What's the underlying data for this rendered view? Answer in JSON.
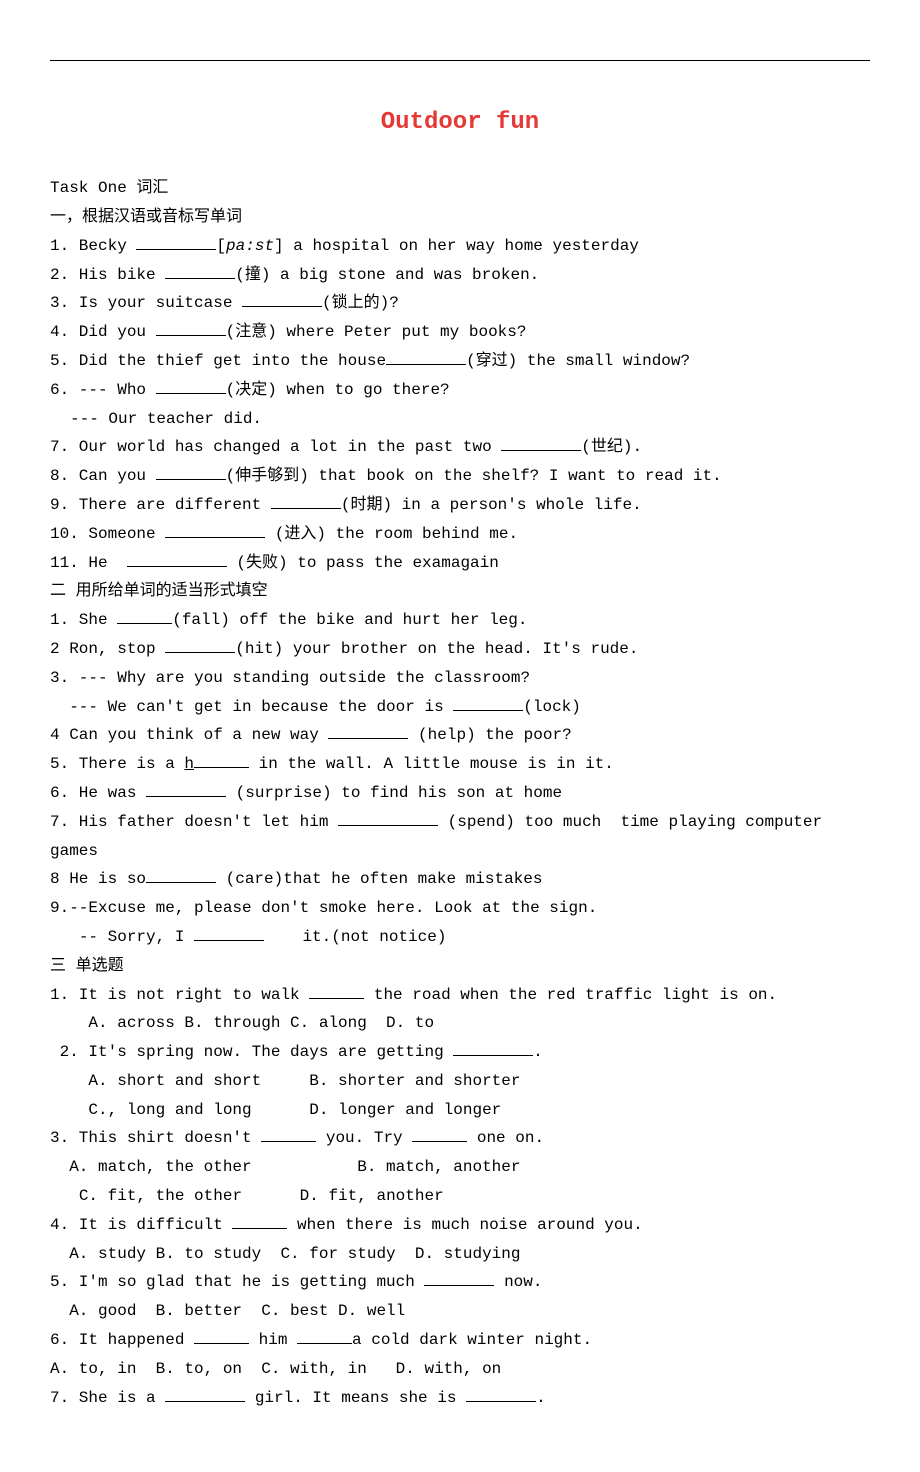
{
  "title": "Outdoor fun",
  "task_label": "Task One 词汇",
  "section1": {
    "heading": "一，根据汉语或音标写单词",
    "items": [
      {
        "pre": "1. Becky ",
        "post": "[",
        "ipa": "pa:st",
        "post2": "] a hospital on her way home yesterday"
      },
      {
        "pre": "2. His bike ",
        "post": "(撞) a big stone and was broken."
      },
      {
        "pre": "3. Is your suitcase ",
        "post": "(锁上的)?"
      },
      {
        "pre": "4. Did you ",
        "post": "(注意) where Peter put my books?"
      },
      {
        "pre": "5. Did the thief get into the house",
        "post": "(穿过) the small window?"
      },
      {
        "pre": "6. --- Who ",
        "post": "(决定) when to go there?"
      },
      {
        "sub": "--- Our teacher did."
      },
      {
        "pre": "7. Our world has changed a lot in the past two ",
        "post": "(世纪)."
      },
      {
        "pre": "8. Can you ",
        "post": "(伸手够到) that book on the shelf? I want to read it."
      },
      {
        "pre": "9. There are different ",
        "post": "(时期) in a person's whole life."
      },
      {
        "pre": "10. Someone ",
        "post": " (进入) the room behind me."
      },
      {
        "pre": "11. He  ",
        "post": " (失败) to pass the examagain"
      }
    ]
  },
  "section2": {
    "heading": "二 用所给单词的适当形式填空",
    "items": [
      {
        "pre": "1. She ",
        "post": "(fall) off the bike and hurt her leg."
      },
      {
        "pre": "2 Ron, stop ",
        "post": "(hit) your brother on the head. It's rude."
      },
      {
        "text": "3. --- Why are you standing outside the classroom?"
      },
      {
        "pre": "  --- We can't get in because the door is ",
        "post": "(lock)"
      },
      {
        "pre": "4 Can you think of a new way ",
        "post": " (help) the poor?"
      },
      {
        "pre": "5. There is a ",
        "uletter": "h",
        "post": " in the wall. A little mouse is in it."
      },
      {
        "pre": "6. He was ",
        "post": " (surprise) to find his son at home"
      },
      {
        "pre": "7. His father doesn't let him ",
        "post": " (spend) too much  time playing computer games"
      },
      {
        "pre": "8 He is so",
        "post": " (care)that he often make mistakes"
      },
      {
        "text": "9.--Excuse me, please don't smoke here. Look at the sign."
      },
      {
        "pre": "   -- Sorry, I ",
        "post": "    it.(not notice)"
      }
    ]
  },
  "section3": {
    "heading": "三 单选题",
    "items": [
      {
        "pre": "1. It is not right to walk ",
        "post": " the road when the red traffic light is on."
      },
      {
        "opts": "    A. across B. through C. along  D. to"
      },
      {
        "pre": " 2. It's spring now. The days are getting ",
        "post": "."
      },
      {
        "opts": "    A. short and short     B. shorter and shorter"
      },
      {
        "opts": "    C., long and long      D. longer and longer"
      },
      {
        "pre": "3. This shirt doesn't ",
        "mid": " you. Try ",
        "post": " one on."
      },
      {
        "opts": "  A. match, the other           B. match, another"
      },
      {
        "opts": "   C. fit, the other      D. fit, another"
      },
      {
        "pre": "4. It is difficult ",
        "post": " when there is much noise around you."
      },
      {
        "opts": "  A. study B. to study  C. for study  D. studying"
      },
      {
        "pre": "5. I'm so glad that he is getting much ",
        "post": " now."
      },
      {
        "opts": "  A. good  B. better  C. best D. well"
      },
      {
        "pre": "6. It happened ",
        "mid": " him ",
        "post": "a cold dark winter night."
      },
      {
        "opts": "A. to, in  B. to, on  C. with, in   D. with, on"
      },
      {
        "pre": "7. She is a ",
        "mid": " girl. It means she is ",
        "post": "."
      }
    ]
  }
}
